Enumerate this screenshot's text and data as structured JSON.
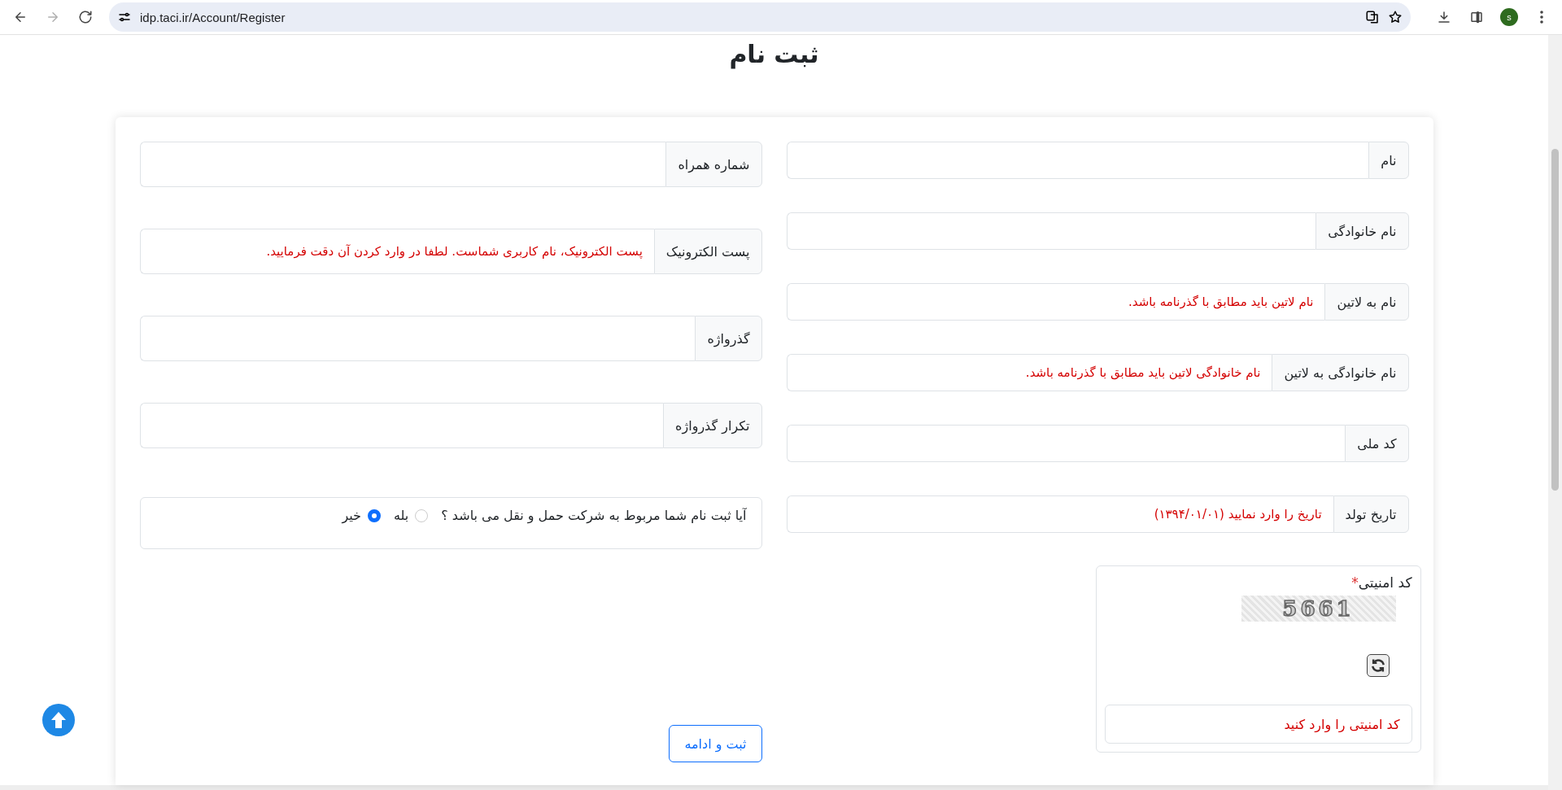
{
  "browser": {
    "url": "idp.taci.ir/Account/Register",
    "forward_disabled": true,
    "avatar": "s"
  },
  "page": {
    "title": "ثبت نام"
  },
  "right_fields": [
    {
      "label": "نام"
    },
    {
      "label": "نام خانوادگی"
    },
    {
      "label": "نام به لاتین",
      "placeholder": "نام لاتین باید مطابق با گذرنامه باشد."
    },
    {
      "label": "نام خانوادگی به لاتین",
      "placeholder": "نام خانوادگی لاتین باید مطابق با گذرنامه باشد."
    },
    {
      "label": "کد ملی"
    },
    {
      "label": "تاریخ تولد",
      "placeholder": "تاریخ را وارد نمایید (۱۳۹۴/۰۱/۰۱)"
    }
  ],
  "left_fields": [
    {
      "label": "شماره همراه"
    },
    {
      "label": "پست الکترونیک",
      "placeholder": "پست الکترونیک، نام کاربری شماست. لطفا در وارد کردن آن دقت فرمایید."
    },
    {
      "label": "گذرواژه"
    },
    {
      "label": "تکرار گذرواژه"
    }
  ],
  "transport_question": {
    "text": "آیا ثبت نام شما مربوط به شرکت حمل و نقل می باشد ؟",
    "options": [
      {
        "label": "بله",
        "selected": false
      },
      {
        "label": "خیر",
        "selected": true
      }
    ]
  },
  "captcha": {
    "label": "کد امنیتی",
    "required_mark": "*",
    "image_text": "5661",
    "placeholder": "کد امنیتی را وارد کنید"
  },
  "submit": "ثبت و ادامه"
}
